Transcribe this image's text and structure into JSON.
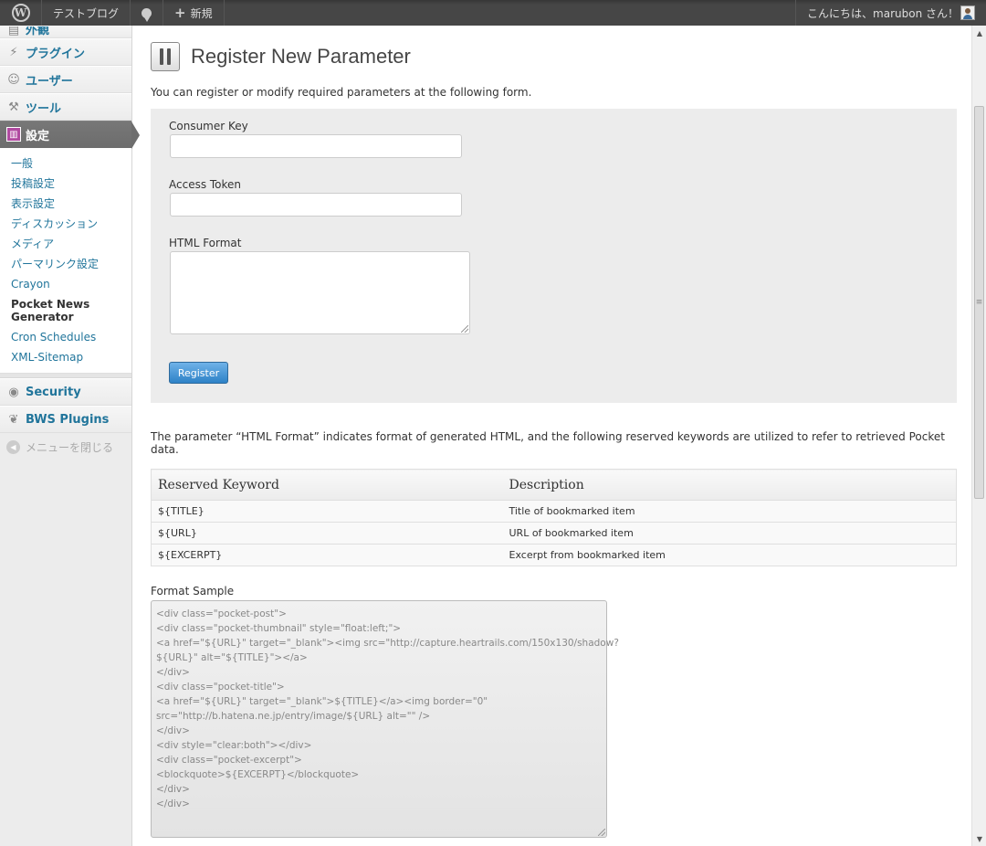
{
  "admin_bar": {
    "logo_icon": "wordpress-icon",
    "site_name": "テストブログ",
    "comments_icon": "comment-bubble-icon",
    "new_label": "新規",
    "greeting": "こんにちは、marubon さん！"
  },
  "sidebar": {
    "partial_item": "外観",
    "items": [
      {
        "label": "プラグイン",
        "icon": "plug-icon"
      },
      {
        "label": "ユーザー",
        "icon": "users-icon"
      },
      {
        "label": "ツール",
        "icon": "tools-icon"
      },
      {
        "label": "設定",
        "icon": "settings-icon"
      }
    ],
    "submenu": [
      {
        "label": "一般"
      },
      {
        "label": "投稿設定"
      },
      {
        "label": "表示設定"
      },
      {
        "label": "ディスカッション"
      },
      {
        "label": "メディア"
      },
      {
        "label": "パーマリンク設定"
      },
      {
        "label": "Crayon"
      },
      {
        "label": "Pocket News Generator"
      },
      {
        "label": "Cron Schedules"
      },
      {
        "label": "XML-Sitemap"
      }
    ],
    "plugins": [
      {
        "label": "Security",
        "icon": "security-icon"
      },
      {
        "label": "BWS Plugins",
        "icon": "bws-icon"
      }
    ],
    "collapse_label": "メニューを閉じる"
  },
  "main": {
    "title": "Register New Parameter",
    "intro": "You can register or modify required parameters at the following form.",
    "form": {
      "consumer_key_label": "Consumer Key",
      "consumer_key_value": "",
      "access_token_label": "Access Token",
      "access_token_value": "",
      "html_format_label": "HTML Format",
      "html_format_value": "",
      "register_label": "Register"
    },
    "description": "The parameter “HTML Format” indicates format of generated HTML, and the following reserved keywords are utilized to refer to retrieved Pocket data.",
    "table": {
      "headers": [
        "Reserved Keyword",
        "Description"
      ],
      "rows": [
        [
          "${TITLE}",
          "Title of bookmarked item"
        ],
        [
          "${URL}",
          "URL of bookmarked item"
        ],
        [
          "${EXCERPT}",
          "Excerpt from bookmarked item"
        ]
      ]
    },
    "sample_label": "Format Sample",
    "sample_lines": [
      "<div class=\"pocket-post\">",
      "<div class=\"pocket-thumbnail\" style=\"float:left;\">",
      "<a href=\"${URL}\" target=\"_blank\"><img src=\"http://capture.heartrails.com/150x130/shadow?",
      "${URL}\" alt=\"${TITLE}\"></a>",
      "</div>",
      "<div class=\"pocket-title\">",
      "<a href=\"${URL}\" target=\"_blank\">${TITLE}</a><img border=\"0\"",
      "src=\"http://b.hatena.ne.jp/entry/image/${URL} alt=\"\" />",
      "</div>",
      "<div style=\"clear:both\"></div>",
      "<div class=\"pocket-excerpt\">",
      "<blockquote>${EXCERPT}</blockquote>",
      "</div>",
      "</div>"
    ]
  }
}
